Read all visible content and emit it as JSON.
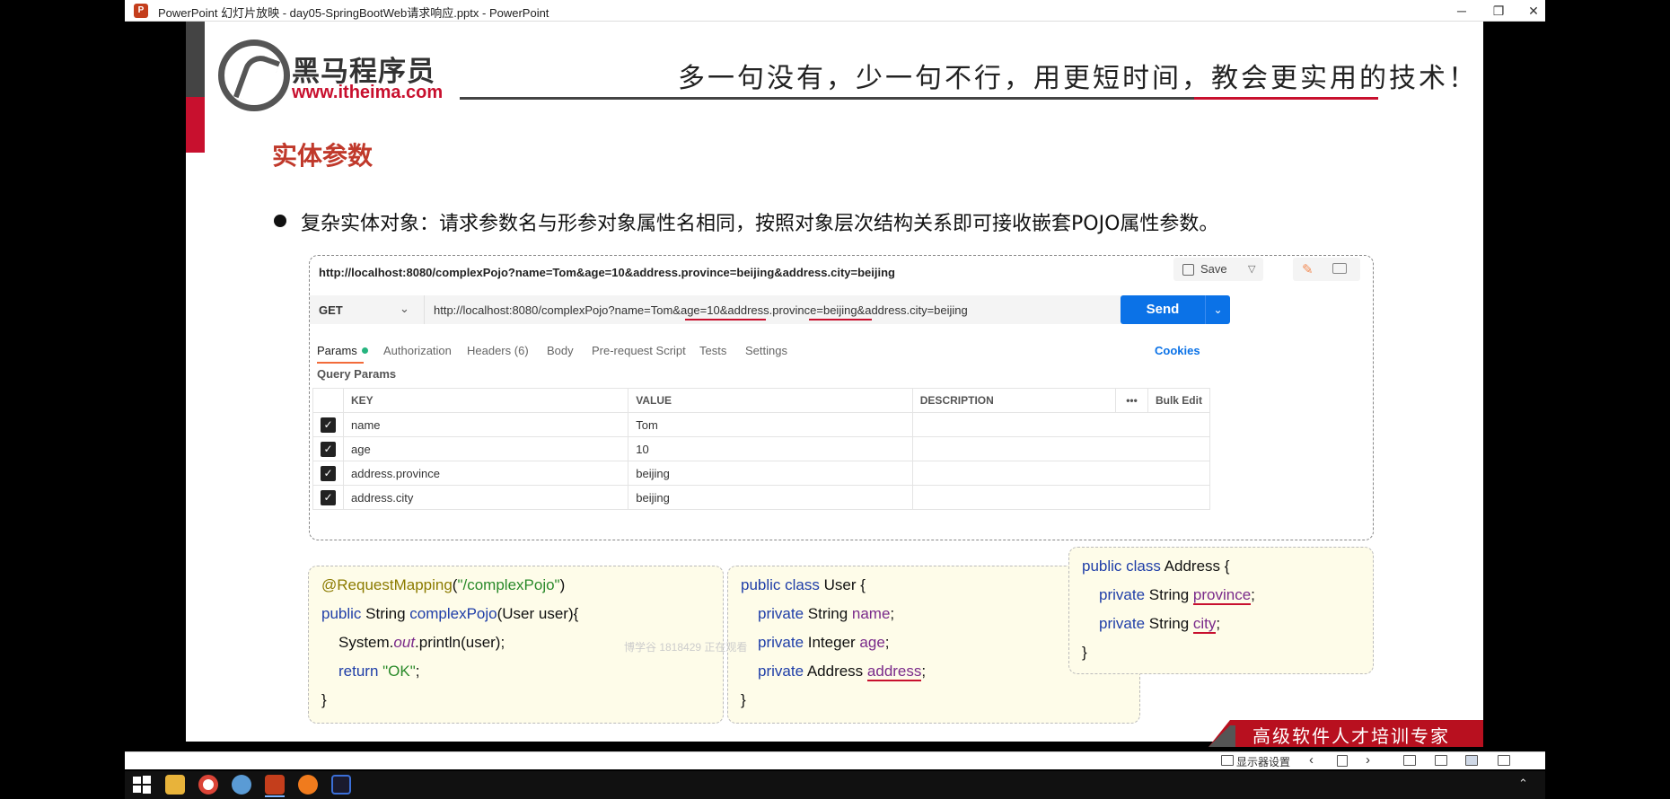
{
  "window": {
    "title": "PowerPoint 幻灯片放映  -  day05-SpringBootWeb请求响应.pptx - PowerPoint",
    "app_icon": "P",
    "minimize": "─",
    "restore": "❐",
    "close": "✕"
  },
  "slide": {
    "logo_cn": "黑马程序员",
    "logo_url": "www.itheima.com",
    "slogan": "多一句没有，少一句不行，用更短时间，教会更实用的技术！",
    "heading": "实体参数",
    "bullet": "复杂实体对象：请求参数名与形参对象属性名相同，按照对象层次结构关系即可接收嵌套POJO属性参数。",
    "watermark": "博学谷 1818429 正在观看",
    "banner": "高级软件人才培训专家"
  },
  "postman": {
    "url_top": "http://localhost:8080/complexPojo?name=Tom&age=10&address.province=beijing&address.city=beijing",
    "save_label": "Save",
    "method": "GET",
    "url": "http://localhost:8080/complexPojo?name=Tom&age=10&address.province=beijing&address.city=beijing",
    "send_label": "Send",
    "tabs": [
      "Params",
      "Authorization",
      "Headers",
      "Body",
      "Pre-request Script",
      "Tests",
      "Settings"
    ],
    "headers_count": "(6)",
    "cookies": "Cookies",
    "query_params_label": "Query Params",
    "columns": [
      "KEY",
      "VALUE",
      "DESCRIPTION",
      "•••",
      "Bulk Edit"
    ],
    "rows": [
      {
        "key": "name",
        "value": "Tom"
      },
      {
        "key": "age",
        "value": "10"
      },
      {
        "key": "address.province",
        "value": "beijing"
      },
      {
        "key": "address.city",
        "value": "beijing"
      }
    ]
  },
  "code": {
    "controller": {
      "l1_ann": "@RequestMapping",
      "l1_paren_open": "(",
      "l1_str": "\"/complexPojo\"",
      "l1_paren_close": ")",
      "l2_kw": "public",
      "l2_type": " String ",
      "l2_method": "complexPojo",
      "l2_rest": "(User user){",
      "l3_a": "System.",
      "l3_out": "out",
      "l3_b": ".println(user);",
      "l4_kw": "return",
      "l4_str": " \"OK\"",
      "l4_end": ";",
      "l5": "}"
    },
    "user": {
      "l1_kw": "public class",
      "l1_rest": " User {",
      "l2_kw": "private",
      "l2_type": " String ",
      "l2_field": "name",
      "l2_end": ";",
      "l3_kw": "private",
      "l3_type": " Integer ",
      "l3_field": "age",
      "l3_end": ";",
      "l4_kw": "private",
      "l4_type": " Address ",
      "l4_field": "address",
      "l4_end": ";",
      "l5": "}"
    },
    "address": {
      "l1_kw": "public class",
      "l1_rest": " Address {",
      "l2_kw": "private",
      "l2_type": " String ",
      "l2_field": "province",
      "l2_end": ";",
      "l3_kw": "private",
      "l3_type": " String ",
      "l3_field": "city",
      "l3_end": ";",
      "l4": "}"
    }
  },
  "statusbar": {
    "display_settings": "显示器设置"
  },
  "colors": {
    "accent_red": "#c8102e",
    "send_blue": "#0b72e7",
    "code_bg": "#fefce9"
  }
}
